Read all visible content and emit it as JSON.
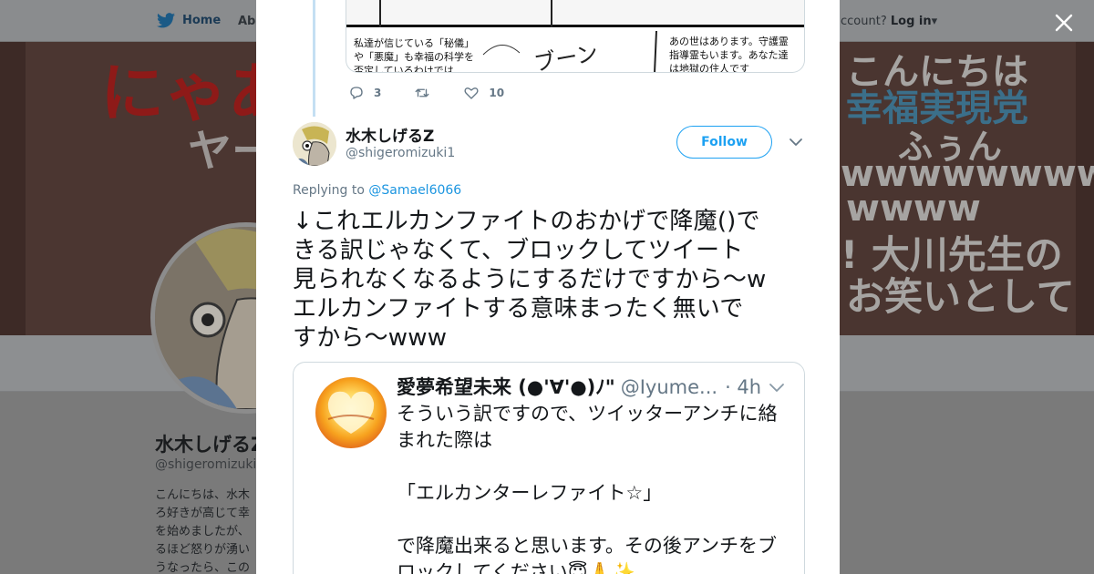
{
  "nav": {
    "home": "Home",
    "about": "Abo",
    "login_prefix": "ccount?",
    "login": "Log in"
  },
  "banner": {
    "left_red": "にゃあ",
    "left_grey": "ヤー",
    "right_lines": [
      "こんにちは",
      "幸福実現党",
      "ふぅん",
      "wwwwwwwww",
      "wwww",
      "! 大川先生の",
      "お笑いとして"
    ]
  },
  "profile": {
    "name": "水木しげるZ",
    "handle": "@shigeromizuki1",
    "bio": [
      "こんにちは、水木",
      "ろ好きが高じて幸",
      "を始めましたが、",
      "るほど怒りが湧い",
      "うなったら、この"
    ]
  },
  "prev_tweet": {
    "manga_caption_left": [
      "私達が信じている「秘儀」",
      "や「悪魔」も幸福の科学を",
      "否定しているわけでは"
    ],
    "manga_caption_right": [
      "あの世はあります。守護霊",
      "指導霊もいます。あなた達",
      "は地獄の住人です"
    ],
    "manga_sfx": "ブーン",
    "reply_count": "3",
    "like_count": "10"
  },
  "tweet": {
    "author_name": "水木しげるZ",
    "author_handle": "@shigeromizuki1",
    "follow_label": "Follow",
    "replying_prefix": "Replying to ",
    "replying_handle": "@Samael6066",
    "text_lines": [
      "↓これエルカンファイトのおかげで降魔()で",
      "きる訳じゃなくて、ブロックしてツイート",
      "見られなくなるようにするだけですから〜w",
      "エルカンファイトする意味まったく無いで",
      "すから〜www"
    ]
  },
  "quote": {
    "name": "愛夢希望未来 (●'∀'●)ﾉ\"",
    "handle": "@Iyume...",
    "time": "· 4h",
    "body_lines": [
      "そういう訳ですので、ツイッターアンチに絡",
      "まれた際は",
      "",
      "「エルカンターレファイト☆」",
      "",
      "で降魔出来ると思います。その後アンチをブ",
      "ロックしてください😇🙏✨"
    ]
  },
  "colors": {
    "accent": "#1da1f2",
    "link": "#1b95e0",
    "muted": "#657786",
    "text": "#14171a"
  }
}
